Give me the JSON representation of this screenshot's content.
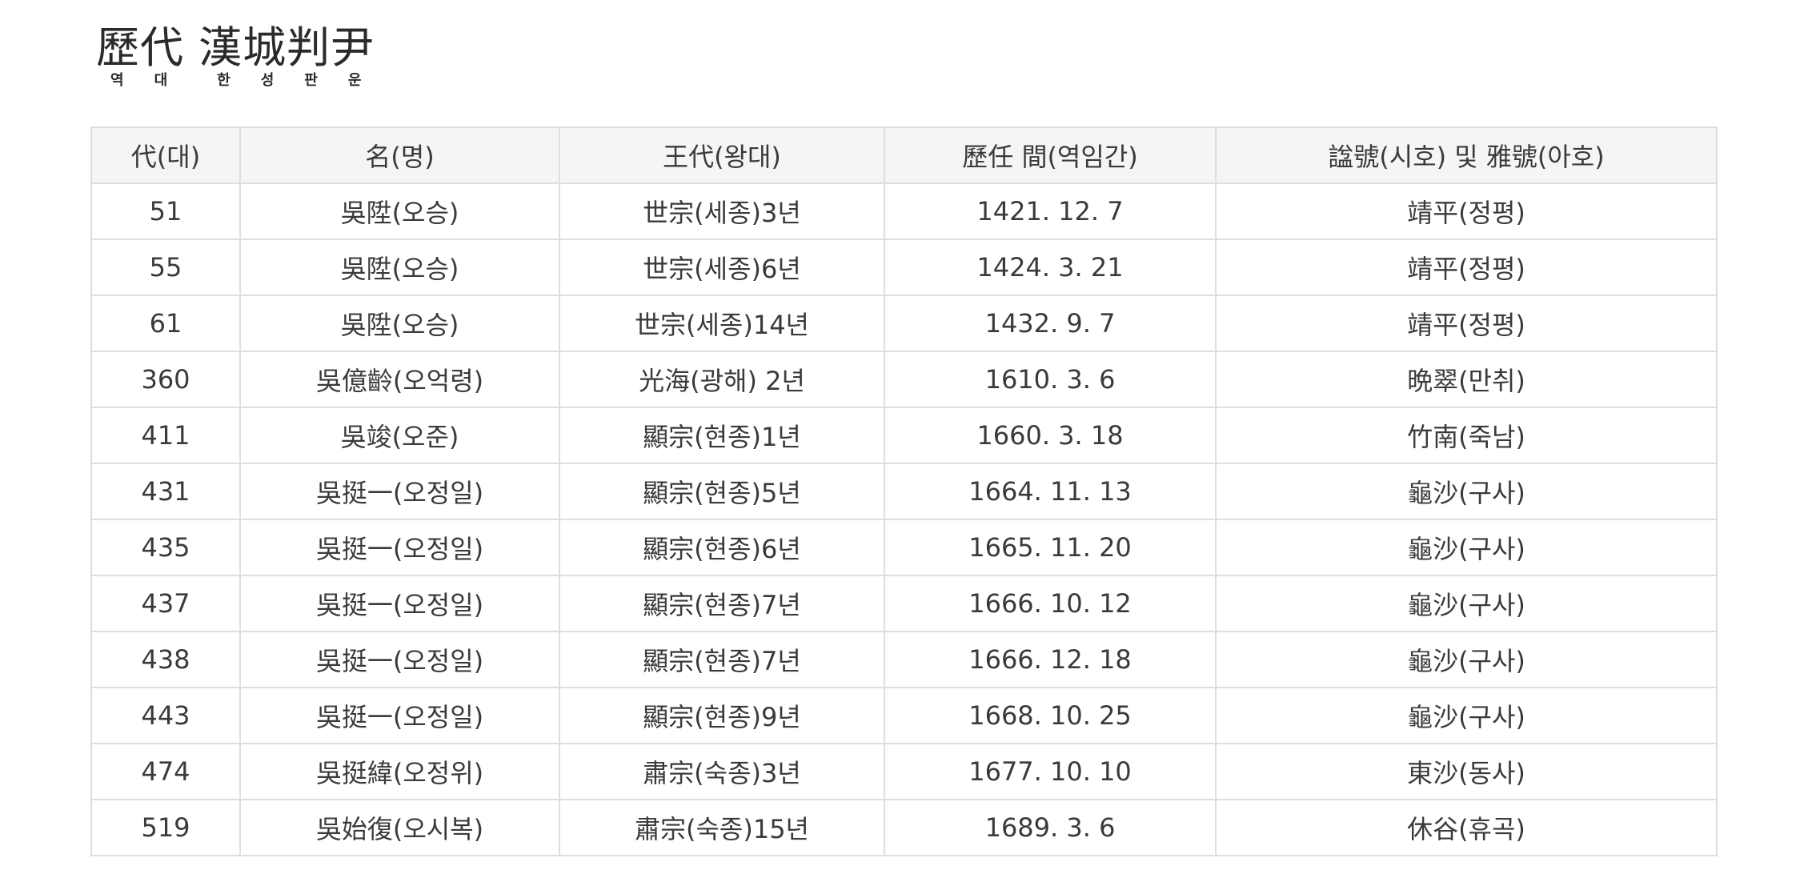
{
  "logo": {
    "hanja": "歷代 漢城判尹",
    "hangul": [
      "역",
      "대",
      "한",
      "성",
      "판",
      "운"
    ]
  },
  "table": {
    "headers": [
      "代(대)",
      "名(명)",
      "王代(왕대)",
      "歷任 間(역임간)",
      "諡號(시호) 및 雅號(아호)"
    ],
    "rows": [
      [
        "51",
        "吳陞(오승)",
        "世宗(세종)3년",
        "1421. 12. 7",
        "靖平(정평)"
      ],
      [
        "55",
        "吳陞(오승)",
        "世宗(세종)6년",
        "1424. 3. 21",
        "靖平(정평)"
      ],
      [
        "61",
        "吳陞(오승)",
        "世宗(세종)14년",
        "1432. 9. 7",
        "靖平(정평)"
      ],
      [
        "360",
        "吳億齡(오억령)",
        "光海(광해) 2년",
        "1610. 3. 6",
        "晩翠(만취)"
      ],
      [
        "411",
        "吳竣(오준)",
        "顯宗(현종)1년",
        "1660. 3. 18",
        "竹南(죽남)"
      ],
      [
        "431",
        "吳挺一(오정일)",
        "顯宗(현종)5년",
        "1664. 11. 13",
        "龜沙(구사)"
      ],
      [
        "435",
        "吳挺一(오정일)",
        "顯宗(현종)6년",
        "1665. 11. 20",
        "龜沙(구사)"
      ],
      [
        "437",
        "吳挺一(오정일)",
        "顯宗(현종)7년",
        "1666. 10. 12",
        "龜沙(구사)"
      ],
      [
        "438",
        "吳挺一(오정일)",
        "顯宗(현종)7년",
        "1666. 12. 18",
        "龜沙(구사)"
      ],
      [
        "443",
        "吳挺一(오정일)",
        "顯宗(현종)9년",
        "1668. 10. 25",
        "龜沙(구사)"
      ],
      [
        "474",
        "吳挺緯(오정위)",
        "肅宗(숙종)3년",
        "1677. 10. 10",
        "東沙(동사)"
      ],
      [
        "519",
        "吳始復(오시복)",
        "肅宗(숙종)15년",
        "1689. 3. 6",
        "休谷(휴곡)"
      ]
    ]
  }
}
